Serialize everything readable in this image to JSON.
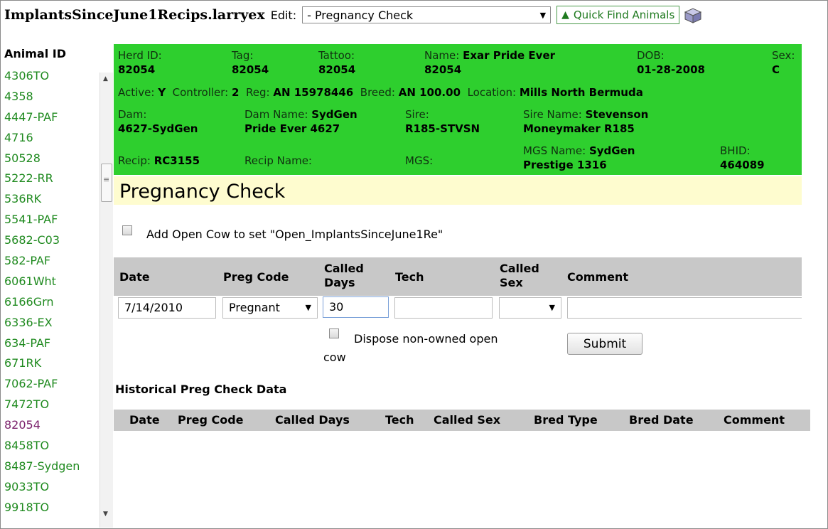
{
  "app_title": "ImplantsSinceJune1Recips.larryex",
  "edit_label": "Edit:",
  "edit_select_value": "- Pregnancy Check",
  "quick_find_label": "Quick Find Animals",
  "sidebar": {
    "header": "Animal ID",
    "items": [
      "4306TO",
      "4358",
      "4447-PAF",
      "4716",
      "50528",
      "5222-RR",
      "536RK",
      "5541-PAF",
      "5682-C03",
      "582-PAF",
      "6061Wht",
      "6166Grn",
      "6336-EX",
      "634-PAF",
      "671RK",
      "7062-PAF",
      "7472TO",
      "82054",
      "8458TO",
      "8487-Sydgen",
      "9033TO",
      "9918TO"
    ],
    "selected": "82054"
  },
  "animal": {
    "herd_id_label": "Herd ID:",
    "herd_id": "82054",
    "tag_label": "Tag:",
    "tag": "82054",
    "tattoo_label": "Tattoo:",
    "tattoo": "82054",
    "name_label": "Name:",
    "name": "Exar Pride Ever",
    "name_cont": "82054",
    "dob_label": "DOB:",
    "dob": "01-28-2008",
    "sex_label": "Sex:",
    "sex": "C",
    "active_label": "Active:",
    "active": "Y",
    "controller_label": "Controller:",
    "controller": "2",
    "reg_label": "Reg:",
    "reg": "AN 15978446",
    "breed_label": "Breed:",
    "breed": "AN 100.00",
    "location_label": "Location:",
    "location": "Mills North Bermuda",
    "dam_label": "Dam:",
    "dam": "4627-SydGen",
    "dam_name_label": "Dam Name:",
    "dam_name": "SydGen",
    "dam_name_cont": "Pride Ever 4627",
    "sire_label": "Sire:",
    "sire": "R185-STVSN",
    "sire_name_label": "Sire Name:",
    "sire_name": "Stevenson",
    "sire_name_cont": "Moneymaker R185",
    "recip_label": "Recip:",
    "recip": "RC3155",
    "recip_name_label": "Recip Name:",
    "mgs_label": "MGS:",
    "mgs_name_label": "MGS Name:",
    "mgs_name": "SydGen",
    "mgs_name_cont": "Prestige 1316",
    "bhid_label": "BHID:",
    "bhid": "464089"
  },
  "preg_check": {
    "title": "Pregnancy Check",
    "add_open_label": "Add Open Cow to set \"Open_ImplantsSinceJune1Re\"",
    "headers": {
      "date": "Date",
      "preg_code": "Preg Code",
      "called_days_1": "Called",
      "called_days_2": "Days",
      "tech": "Tech",
      "called_sex_1": "Called",
      "called_sex_2": "Sex",
      "comment": "Comment"
    },
    "date_value": "7/14/2010",
    "preg_code_value": "Pregnant",
    "called_days_value": "30",
    "tech_value": "",
    "called_sex_value": "",
    "comment_value": "",
    "dispose_label_1": "Dispose non-owned open",
    "dispose_label_2": "cow",
    "submit_label": "Submit"
  },
  "history": {
    "title": "Historical Preg Check Data",
    "columns": [
      "Date",
      "Preg Code",
      "Called Days",
      "Tech",
      "Called Sex",
      "Bred Type",
      "Bred Date",
      "Comment"
    ]
  }
}
